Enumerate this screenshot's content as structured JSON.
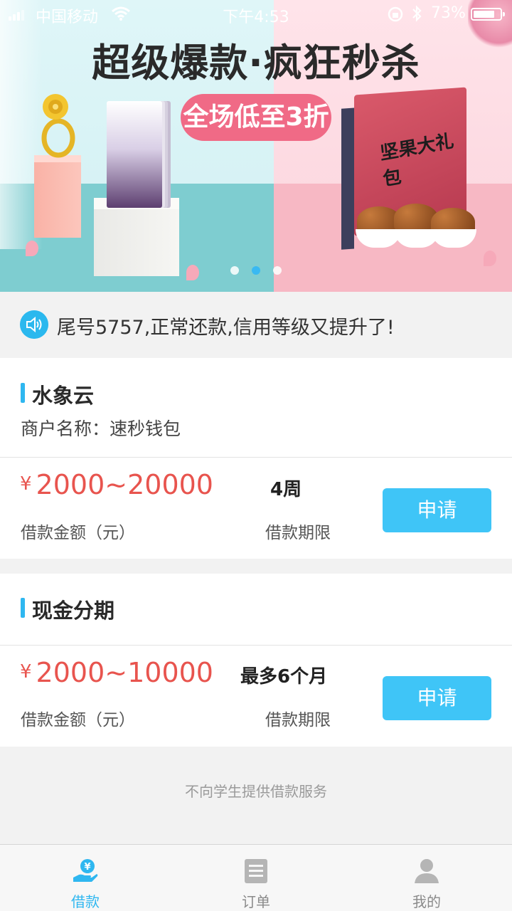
{
  "status_bar": {
    "carrier": "中国移动",
    "time": "下午4:53",
    "battery": "73%"
  },
  "banner": {
    "headline": "超级爆款·疯狂秒杀",
    "promo_pill": "全场低至3折",
    "gift_box_text": "坚果大礼包",
    "slides": 3,
    "active_slide": 2
  },
  "notice": {
    "text": "尾号5757,正常还款,信用等级又提升了!"
  },
  "products": [
    {
      "title": "水象云",
      "merchant": "商户名称：速秒钱包",
      "currency_symbol": "¥",
      "amount_range": "2000~20000",
      "amount_label": "借款金额（元）",
      "term": "4周",
      "term_label": "借款期限",
      "apply_label": "申请"
    },
    {
      "title": "现金分期",
      "currency_symbol": "¥",
      "amount_range": "2000~10000",
      "amount_label": "借款金额（元）",
      "term": "最多6个月",
      "term_label": "借款期限",
      "apply_label": "申请"
    }
  ],
  "footnote": "不向学生提供借款服务",
  "tabbar": {
    "items": [
      {
        "label": "借款",
        "icon": "loan-hand-yen-icon",
        "active": true
      },
      {
        "label": "订单",
        "icon": "order-list-icon",
        "active": false
      },
      {
        "label": "我的",
        "icon": "user-profile-icon",
        "active": false
      }
    ]
  },
  "colors": {
    "accent_blue": "#2fb7f0",
    "button_blue": "#3fc5f7",
    "amount_red": "#e8544e",
    "promo_pink": "#f06a86"
  }
}
